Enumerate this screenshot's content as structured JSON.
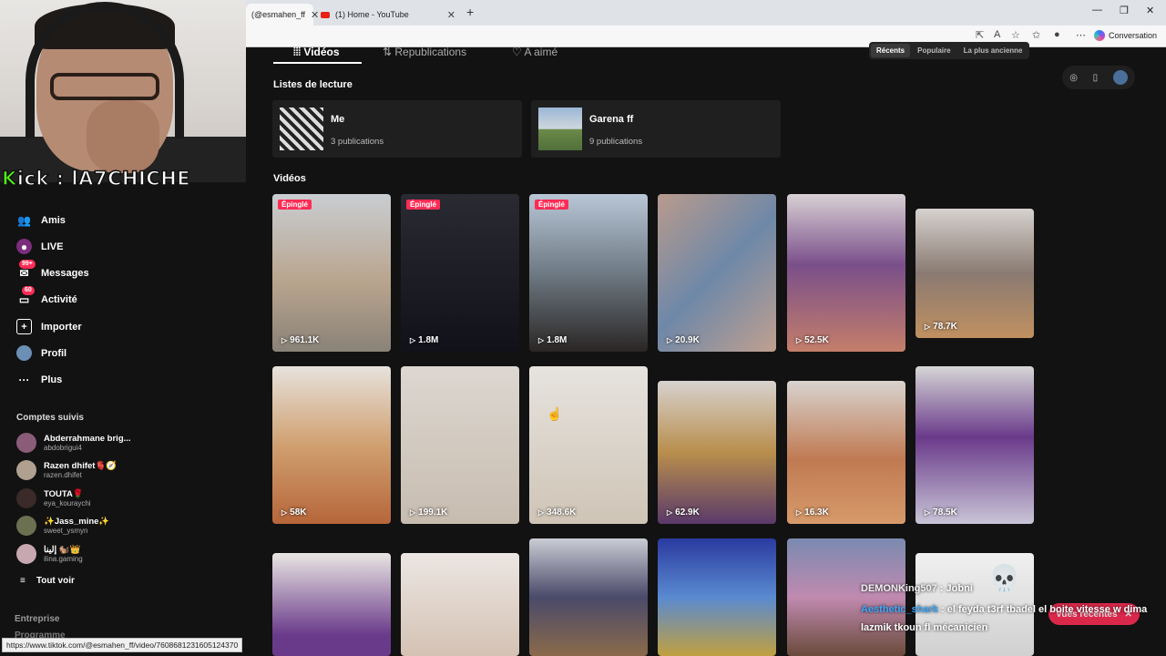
{
  "browser": {
    "tabs": [
      {
        "label": "(@esmahen_ff",
        "active": true
      },
      {
        "label": "(1) Home - YouTube",
        "active": false
      }
    ],
    "toolbar_right": {
      "conversation_label": "Conversation"
    },
    "status_url": "https://www.tiktok.com/@esmahen_ff/video/7608681231605124370"
  },
  "overlay": {
    "kick_prefix": "K",
    "kick_text": "ick : lA7CHICHE",
    "chat": [
      {
        "user": "DEMONKing507",
        "sep": " : ",
        "message": "Jobni"
      },
      {
        "user": "Aesthetic_shark",
        "sep": " : ",
        "message": "el feyda t3rf tbadel el boite vitesse w dima lazmik tkoun fl mécanicien"
      }
    ],
    "recent_label": "Vues récentes"
  },
  "sidebar": {
    "nav": [
      {
        "label": "Amis",
        "icon": "friends-icon",
        "badge": ""
      },
      {
        "label": "LIVE",
        "icon": "live-icon",
        "badge": ""
      },
      {
        "label": "Messages",
        "icon": "messages-icon",
        "badge": "99+"
      },
      {
        "label": "Activité",
        "icon": "activity-icon",
        "badge": "60"
      },
      {
        "label": "Importer",
        "icon": "upload-icon",
        "badge": ""
      },
      {
        "label": "Profil",
        "icon": "profile-icon",
        "badge": ""
      },
      {
        "label": "Plus",
        "icon": "more-icon",
        "badge": ""
      }
    ],
    "following_title": "Comptes suivis",
    "following": [
      {
        "name": "Abderrahmane brig...",
        "handle": "abdobrigui4"
      },
      {
        "name": "Razen dhifet🫀🧭",
        "handle": "razen.dhifet"
      },
      {
        "name": "TOUTA🌹",
        "handle": "eya_kouraychi"
      },
      {
        "name": "✨Jass_mine✨",
        "handle": "sweet_ysmyn"
      },
      {
        "name": "إلينا 🐿️👑",
        "handle": "ilina.gaming"
      }
    ],
    "see_all": "Tout voir",
    "footer": [
      "Entreprise",
      "Programme"
    ]
  },
  "profile": {
    "tabs": [
      "Vidéos",
      "Republications",
      "A aimé"
    ],
    "sort": [
      "Récents",
      "Populaire",
      "La plus ancienne"
    ],
    "playlists_title": "Listes de lecture",
    "playlists": [
      {
        "name": "Me",
        "count": "3 publications"
      },
      {
        "name": "Garena ff",
        "count": "9 publications"
      }
    ],
    "videos_title": "Vidéos",
    "pinned_label": "Épinglé",
    "videos": [
      {
        "views": "961.1K",
        "pinned": true
      },
      {
        "views": "1.8M",
        "pinned": true
      },
      {
        "views": "1.8M",
        "pinned": true
      },
      {
        "views": "20.9K",
        "pinned": false
      },
      {
        "views": "52.5K",
        "pinned": false
      },
      {
        "views": "78.7K",
        "pinned": false
      },
      {
        "views": "58K",
        "pinned": false
      },
      {
        "views": "199.1K",
        "pinned": false
      },
      {
        "views": "348.6K",
        "pinned": false
      },
      {
        "views": "62.9K",
        "pinned": false
      },
      {
        "views": "16.3K",
        "pinned": false
      },
      {
        "views": "78.5K",
        "pinned": false
      },
      {
        "views": "",
        "pinned": false
      },
      {
        "views": "",
        "pinned": false
      },
      {
        "views": "",
        "pinned": false
      },
      {
        "views": "",
        "pinned": false
      },
      {
        "views": "",
        "pinned": false
      },
      {
        "views": "",
        "pinned": false
      }
    ]
  }
}
